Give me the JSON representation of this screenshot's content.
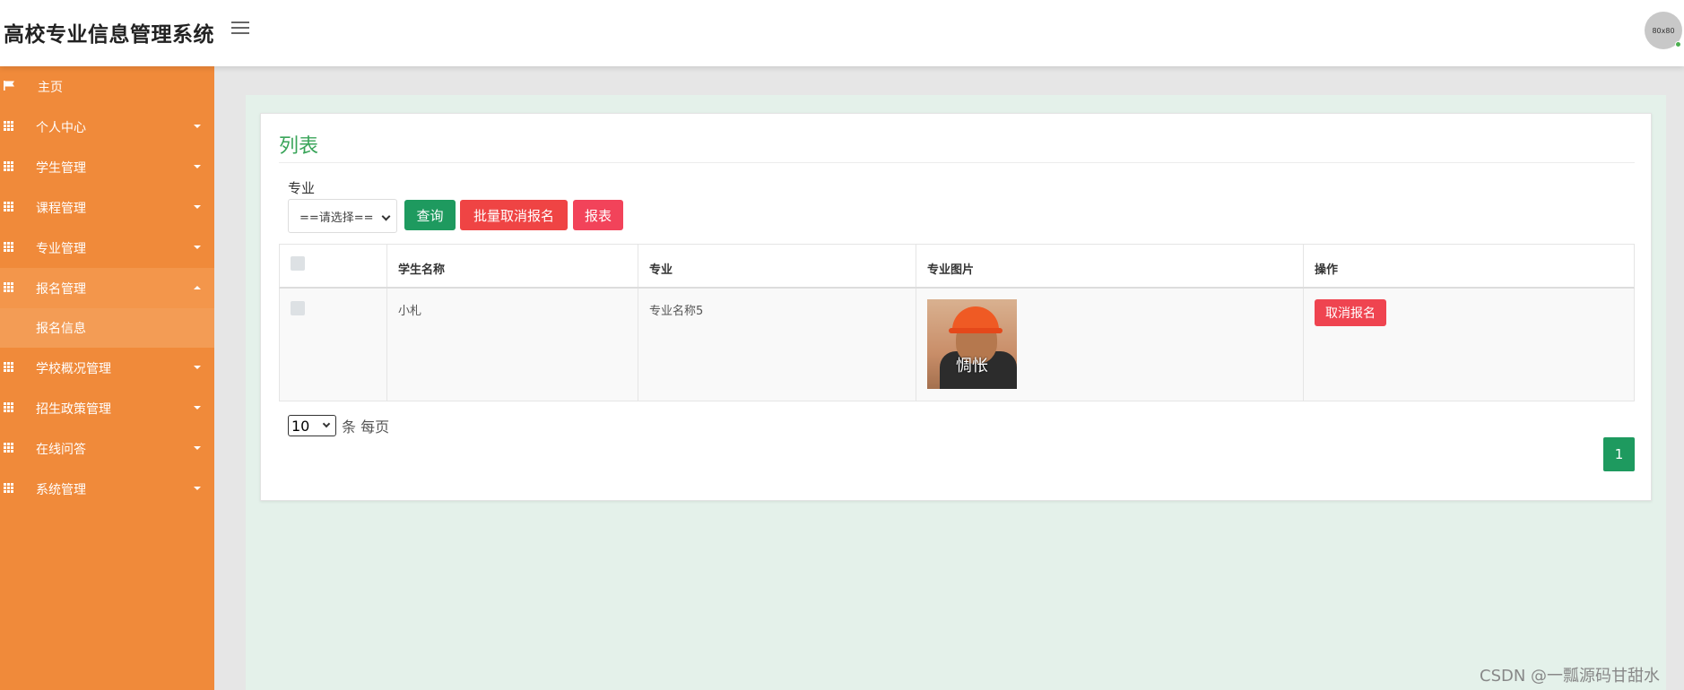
{
  "header": {
    "app_title": "高校专业信息管理系统",
    "avatar_text": "80x80"
  },
  "sidebar": {
    "items": [
      {
        "label": "主页",
        "icon": "flag-icon"
      },
      {
        "label": "个人中心",
        "icon": "grid-icon"
      },
      {
        "label": "学生管理",
        "icon": "grid-icon"
      },
      {
        "label": "课程管理",
        "icon": "grid-icon"
      },
      {
        "label": "专业管理",
        "icon": "grid-icon"
      },
      {
        "label": "报名管理",
        "icon": "grid-icon",
        "expanded": true
      },
      {
        "label": "学校概况管理",
        "icon": "grid-icon"
      },
      {
        "label": "招生政策管理",
        "icon": "grid-icon"
      },
      {
        "label": "在线问答",
        "icon": "grid-icon"
      },
      {
        "label": "系统管理",
        "icon": "grid-icon"
      }
    ],
    "sub_item": "报名信息"
  },
  "main": {
    "title": "列表",
    "filter": {
      "label": "专业",
      "select_value": "==请选择=="
    },
    "buttons": {
      "query": "查询",
      "batch_cancel": "批量取消报名",
      "report": "报表"
    },
    "table": {
      "headers": [
        "",
        "学生名称",
        "专业",
        "专业图片",
        "操作"
      ],
      "rows": [
        {
          "student_name": "小札",
          "major": "专业名称5",
          "image_caption": "惆怅",
          "action": "取消报名"
        }
      ]
    },
    "pagination": {
      "page_size": "10",
      "page_size_suffix": "条 每页",
      "current_page": "1"
    }
  },
  "watermark": "CSDN @一瓢源码甘甜水",
  "colors": {
    "sidebar": "#f08a3a",
    "primary_green": "#1e9a5f",
    "danger_red": "#ef4444",
    "title_green": "#3aa55a"
  }
}
